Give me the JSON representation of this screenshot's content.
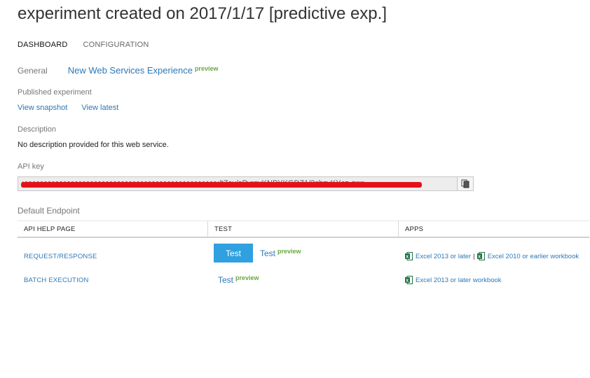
{
  "title": "experiment created on 2017/1/17 [predictive exp.]",
  "tabs": [
    {
      "label": "DASHBOARD"
    },
    {
      "label": "CONFIGURATION"
    }
  ],
  "general": {
    "label": "General",
    "link": "New Web Services Experience",
    "badge": "preview"
  },
  "published": {
    "label": "Published experiment",
    "view_snapshot": "View snapshot",
    "view_latest": "View latest"
  },
  "description": {
    "label": "Description",
    "text": "No description provided for this web service."
  },
  "api_key": {
    "label": "API key",
    "value": "yyyyyyyyyyyyyyyyyyyyyyyyyyyyyyyyyyyyyyyyyyyyyyyyyyy/tZay/sPyrgvKNPYKGDZ1/2chzyKYcz-g==",
    "copy_icon": "copy-icon"
  },
  "endpoint": {
    "label": "Default Endpoint",
    "columns": [
      "API HELP PAGE",
      "TEST",
      "APPS"
    ],
    "rows": [
      {
        "api": "REQUEST/RESPONSE",
        "test_button": "Test",
        "test_link": "Test",
        "test_badge": "preview",
        "apps": [
          "Excel 2013 or later",
          "|",
          "Excel 2010 or earlier workbook"
        ]
      },
      {
        "api": "BATCH EXECUTION",
        "test_link": "Test",
        "test_badge": "preview",
        "apps": [
          "Excel 2013 or later workbook"
        ]
      }
    ]
  },
  "colors": {
    "link": "#2e78b5",
    "preview": "#6aa842",
    "button": "#2fa0e0",
    "redaction": "#e3121a",
    "excel": "#1e7145"
  }
}
